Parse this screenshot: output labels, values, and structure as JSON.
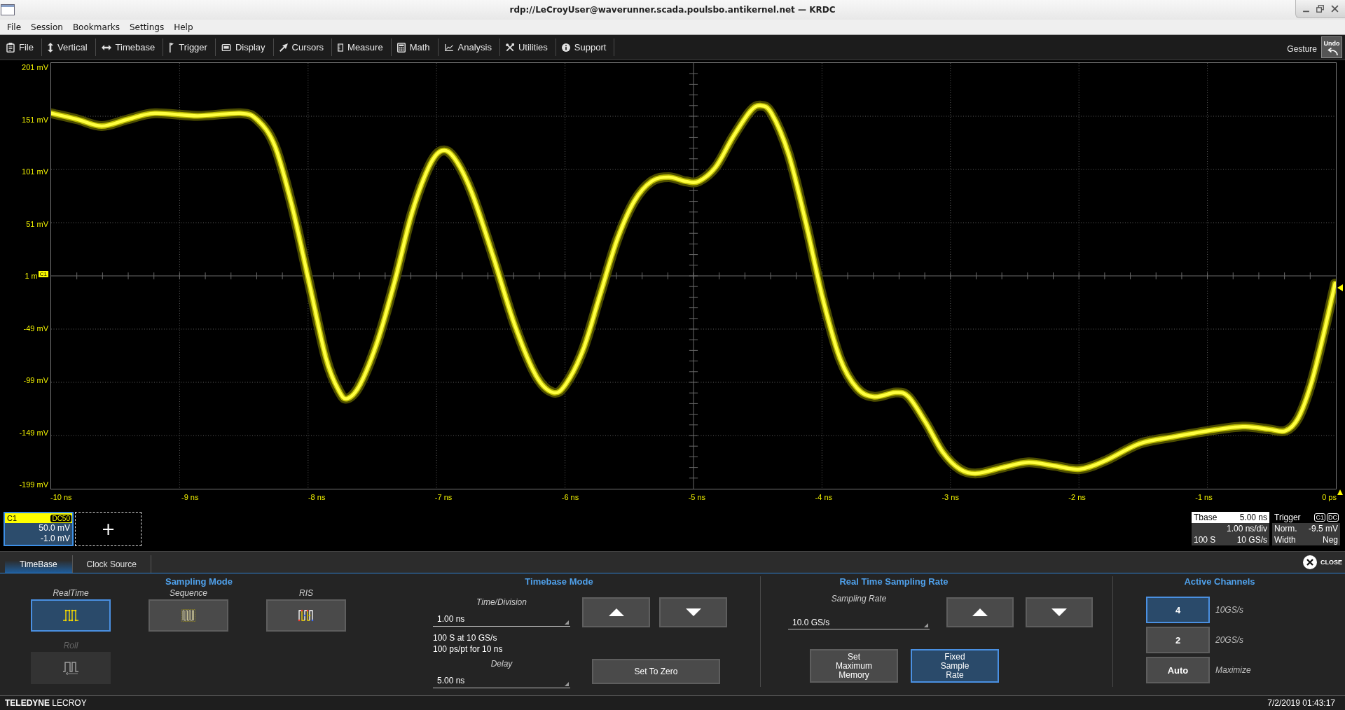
{
  "window": {
    "title": "rdp://LeCroyUser@waverunner.scada.poulsbo.antikernel.net — KRDC"
  },
  "menu": [
    "File",
    "Session",
    "Bookmarks",
    "Settings",
    "Help"
  ],
  "toolbar": {
    "items": [
      {
        "label": "File",
        "kind": "file"
      },
      {
        "label": "Vertical",
        "kind": "vertical"
      },
      {
        "label": "Timebase",
        "kind": "timebase"
      },
      {
        "label": "Trigger",
        "kind": "trigger"
      },
      {
        "label": "Display",
        "kind": "display"
      },
      {
        "label": "Cursors",
        "kind": "cursors"
      },
      {
        "label": "Measure",
        "kind": "measure"
      },
      {
        "label": "Math",
        "kind": "math"
      },
      {
        "label": "Analysis",
        "kind": "analysis"
      },
      {
        "label": "Utilities",
        "kind": "utilities"
      },
      {
        "label": "Support",
        "kind": "support"
      }
    ],
    "gesture_label": "Gesture",
    "undo_label": "Undo"
  },
  "plot": {
    "y_labels": [
      "201 mV",
      "151 mV",
      "101 mV",
      "51 mV",
      "1 m",
      "-49 mV",
      "-99 mV",
      "-149 mV",
      "-199 mV"
    ],
    "x_labels": [
      "-10 ns",
      "-9 ns",
      "-8 ns",
      "-7 ns",
      "-6 ns",
      "-5 ns",
      "-4 ns",
      "-3 ns",
      "-2 ns",
      "-1 ns",
      "0 ps"
    ],
    "channel_marker": "C1"
  },
  "descriptors": {
    "channel": {
      "name": "C1",
      "coupling": "DC50",
      "scale": "50.0 mV",
      "offset": "-1.0 mV"
    },
    "add_channel": "+",
    "timebase": {
      "title": "Tbase",
      "delay": "5.00 ns",
      "scale": "1.00 ns/div",
      "samples": "100 S",
      "rate": "10 GS/s"
    },
    "trigger": {
      "title": "Trigger",
      "source": "C1",
      "coupling": "DC",
      "mode": "Norm.",
      "threshold": "-9.5 mV",
      "type": "Width",
      "slope": "Neg"
    }
  },
  "dialog": {
    "tabs": [
      {
        "label": "TimeBase",
        "selected": true
      },
      {
        "label": "Clock Source",
        "selected": false
      }
    ],
    "close_label": "CLOSE",
    "sampling_mode": {
      "title": "Sampling Mode",
      "modes": [
        {
          "label": "RealTime",
          "kind": "realtime",
          "selected": true,
          "disabled": false
        },
        {
          "label": "Sequence",
          "kind": "sequence",
          "selected": false,
          "disabled": false
        },
        {
          "label": "RIS",
          "kind": "ris",
          "selected": false,
          "disabled": false
        },
        {
          "label": "Roll",
          "kind": "roll",
          "selected": false,
          "disabled": true
        }
      ]
    },
    "timebase_mode": {
      "title": "Timebase Mode",
      "time_per_division": {
        "label": "Time/Division",
        "value": "1.00 ns"
      },
      "info": [
        "100 S at 10 GS/s",
        "100 ps/pt for 10 ns"
      ],
      "delay": {
        "label": "Delay",
        "value": "5.00 ns"
      },
      "set_to_zero": "Set To Zero"
    },
    "sampling_rate": {
      "title": "Real Time Sampling Rate",
      "rate": {
        "label": "Sampling Rate",
        "value": "10.0 GS/s"
      },
      "options": [
        {
          "label": "Set Maximum Memory",
          "selected": false
        },
        {
          "label": "Fixed Sample Rate",
          "selected": true
        }
      ]
    },
    "active_channels": {
      "title": "Active Channels",
      "options": [
        {
          "label": "4",
          "note": "10GS/s",
          "selected": true
        },
        {
          "label": "2",
          "note": "20GS/s",
          "selected": false
        },
        {
          "label": "Auto",
          "note": "Maximize",
          "selected": false
        }
      ]
    }
  },
  "status_bar": {
    "brand": "**TELEDYNE** LECROY",
    "timestamp": "7/2/2019 01:43:17"
  }
}
